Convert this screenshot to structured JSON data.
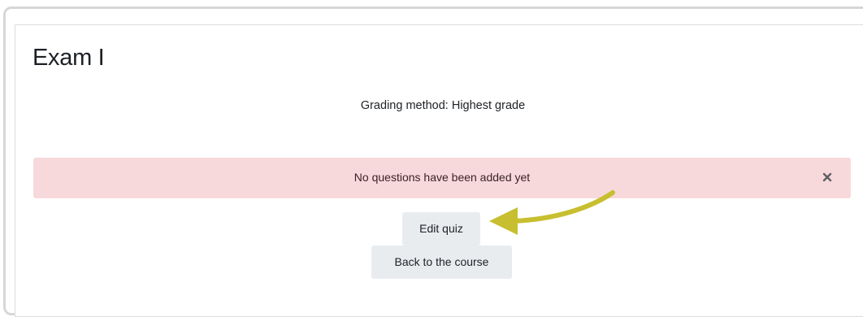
{
  "quiz": {
    "title": "Exam I",
    "grading_method": "Grading method: Highest grade"
  },
  "alert": {
    "message": "No questions have been added yet",
    "close_icon": "close-icon"
  },
  "buttons": {
    "edit_quiz": "Edit quiz",
    "back_to_course": "Back to the course"
  },
  "annotation": {
    "arrow_color": "#c7bf2f"
  },
  "colors": {
    "alert_background": "#f7d9dc",
    "button_background": "#e9ecef"
  }
}
